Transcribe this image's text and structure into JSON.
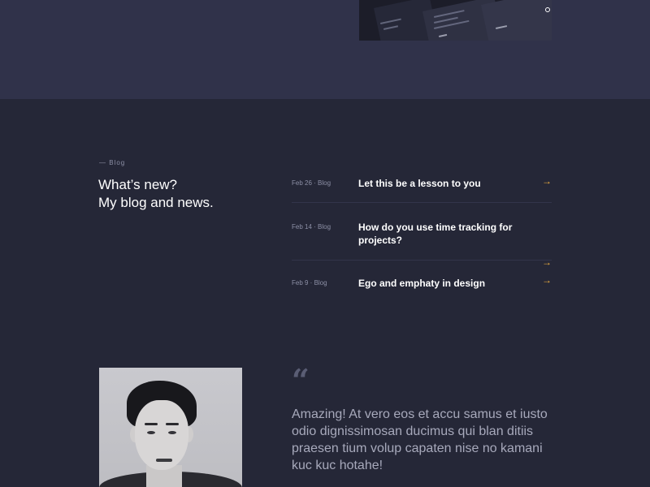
{
  "blog": {
    "eyebrow": "— Blog",
    "heading_line1": "What’s new?",
    "heading_line2": "My blog and news.",
    "posts": [
      {
        "meta": "Feb 26 · Blog",
        "title": "Let this be a lesson to you",
        "arrow": "→"
      },
      {
        "meta": "Feb 14 · Blog",
        "title": "How do you use time tracking for projects?",
        "arrow": "→"
      },
      {
        "meta": "Feb 9 · Blog",
        "title": "Ego and emphaty in design",
        "arrow": "→"
      }
    ]
  },
  "testimonial": {
    "quote_mark": "“",
    "text": "Amazing! At vero eos et accu samus et iusto odio dignissimosan ducimus qui blan ditiis praesen tium volup capaten nise no kamani kuc kuc hotahe!"
  },
  "colors": {
    "page_bg": "#252737",
    "top_band": "#30324a",
    "accent": "#f4b23f",
    "muted_text": "#8d90a6",
    "quote_text": "#a7a9bb"
  },
  "icons": {
    "post_arrow": "arrow-right-icon",
    "quote": "quote-icon",
    "carousel_dot": "dot-icon"
  }
}
